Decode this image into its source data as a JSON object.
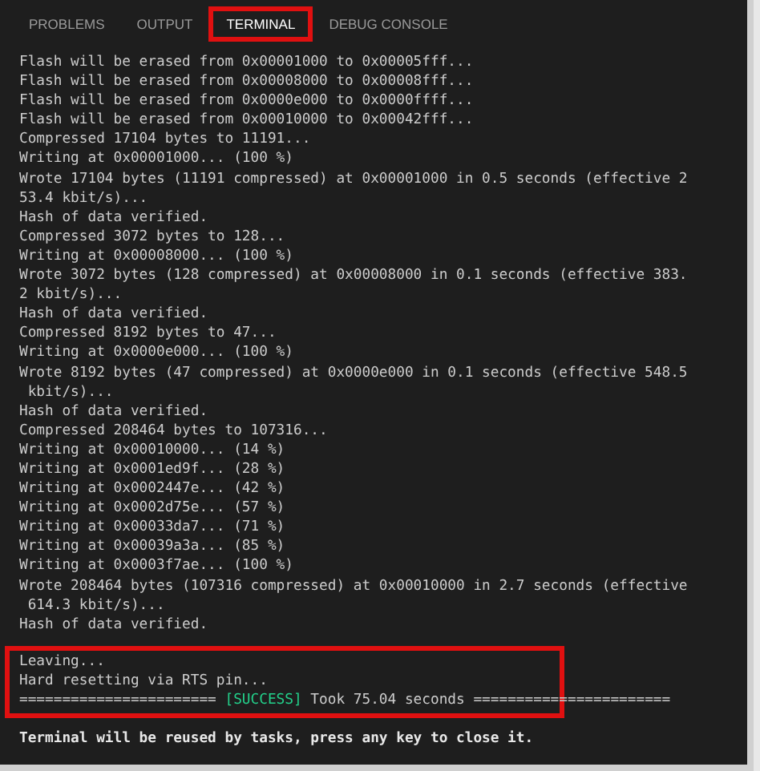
{
  "tabs": [
    {
      "label": "PROBLEMS",
      "selected": false,
      "highlighted": false
    },
    {
      "label": "OUTPUT",
      "selected": false,
      "highlighted": false
    },
    {
      "label": "TERMINAL",
      "selected": true,
      "highlighted": true
    },
    {
      "label": "DEBUG CONSOLE",
      "selected": false,
      "highlighted": false
    }
  ],
  "terminal": {
    "lines": [
      "Flash will be erased from 0x00001000 to 0x00005fff...",
      "Flash will be erased from 0x00008000 to 0x00008fff...",
      "Flash will be erased from 0x0000e000 to 0x0000ffff...",
      "Flash will be erased from 0x00010000 to 0x00042fff...",
      "Compressed 17104 bytes to 11191...",
      "Writing at 0x00001000... (100 %)",
      "Wrote 17104 bytes (11191 compressed) at 0x00001000 in 0.5 seconds (effective 2",
      "53.4 kbit/s)...",
      "Hash of data verified.",
      "Compressed 3072 bytes to 128...",
      "Writing at 0x00008000... (100 %)",
      "Wrote 3072 bytes (128 compressed) at 0x00008000 in 0.1 seconds (effective 383.",
      "2 kbit/s)...",
      "Hash of data verified.",
      "Compressed 8192 bytes to 47...",
      "Writing at 0x0000e000... (100 %)",
      "Wrote 8192 bytes (47 compressed) at 0x0000e000 in 0.1 seconds (effective 548.5",
      " kbit/s)...",
      "Hash of data verified.",
      "Compressed 208464 bytes to 107316...",
      "Writing at 0x00010000... (14 %)",
      "Writing at 0x0001ed9f... (28 %)",
      "Writing at 0x0002447e... (42 %)",
      "Writing at 0x0002d75e... (57 %)",
      "Writing at 0x00033da7... (71 %)",
      "Writing at 0x00039a3a... (85 %)",
      "Writing at 0x0003f7ae... (100 %)",
      "Wrote 208464 bytes (107316 compressed) at 0x00010000 in 2.7 seconds (effective",
      " 614.3 kbit/s)...",
      "Hash of data verified."
    ],
    "highlighted_block": {
      "highlighted": true,
      "lines": [
        "Leaving...",
        "Hard resetting via RTS pin..."
      ],
      "status_line": {
        "prefix": "=======================",
        "status": "[SUCCESS]",
        "suffix": "Took 75.04 seconds ======================="
      }
    },
    "footer": "Terminal will be reused by tasks, press any key to close it."
  }
}
